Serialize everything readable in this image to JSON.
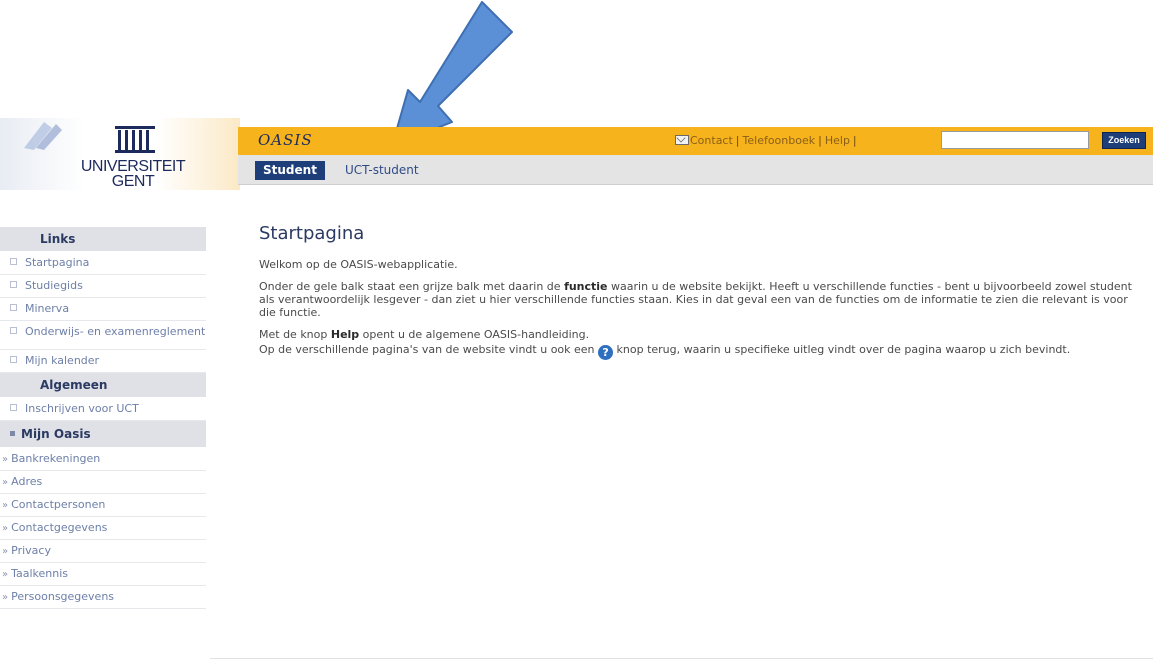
{
  "logo": {
    "line1": "UNIVERSITEIT",
    "line2": "GENT"
  },
  "topbar": {
    "brand": "OASIS",
    "links": [
      "Contact",
      "Telefoonboek",
      "Help"
    ],
    "search_value": "",
    "search_button": "Zoeken",
    "color": "#f6b31b"
  },
  "functionbar": {
    "tabs": [
      {
        "label": "Student",
        "active": true
      },
      {
        "label": "UCT-student",
        "active": false
      }
    ]
  },
  "sidebar": {
    "links_header": "Links",
    "links": [
      "Startpagina",
      "Studiegids",
      "Minerva",
      "Onderwijs- en examenreglement",
      "Mijn kalender"
    ],
    "algemeen_header": "Algemeen",
    "algemeen_items": [
      "Inschrijven voor UCT"
    ],
    "mijn_oasis_header": "Mijn Oasis",
    "mijn_oasis_items": [
      "Bankrekeningen",
      "Adres",
      "Contactpersonen",
      "Contactgegevens",
      "Privacy",
      "Taalkennis",
      "Persoonsgegevens"
    ]
  },
  "main": {
    "title": "Startpagina",
    "welcome": "Welkom op de OASIS-webapplicatie.",
    "p2_a": "Onder de gele balk staat een grijze balk met daarin de ",
    "p2_bold": "functie",
    "p2_b": " waarin u de website bekijkt. Heeft u verschillende functies - bent u bijvoorbeeld zowel student als verantwoordelijk lesgever - dan ziet u hier verschillende functies staan. Kies in dat geval een van de functies om de informatie te zien die relevant is voor die functie.",
    "p3_a": "Met de knop ",
    "p3_bold": "Help",
    "p3_b": " opent u de algemene OASIS-handleiding.",
    "p4_a": "Op de verschillende pagina's van de website vindt u ook een ",
    "p4_b": " knop terug, waarin u specifieke uitleg vindt over de pagina waarop u zich bevindt.",
    "help_icon_glyph": "?"
  },
  "annotation": {
    "arrow_color": "#5b8fd6",
    "arrow_icon": "arrow-down-left-icon"
  }
}
